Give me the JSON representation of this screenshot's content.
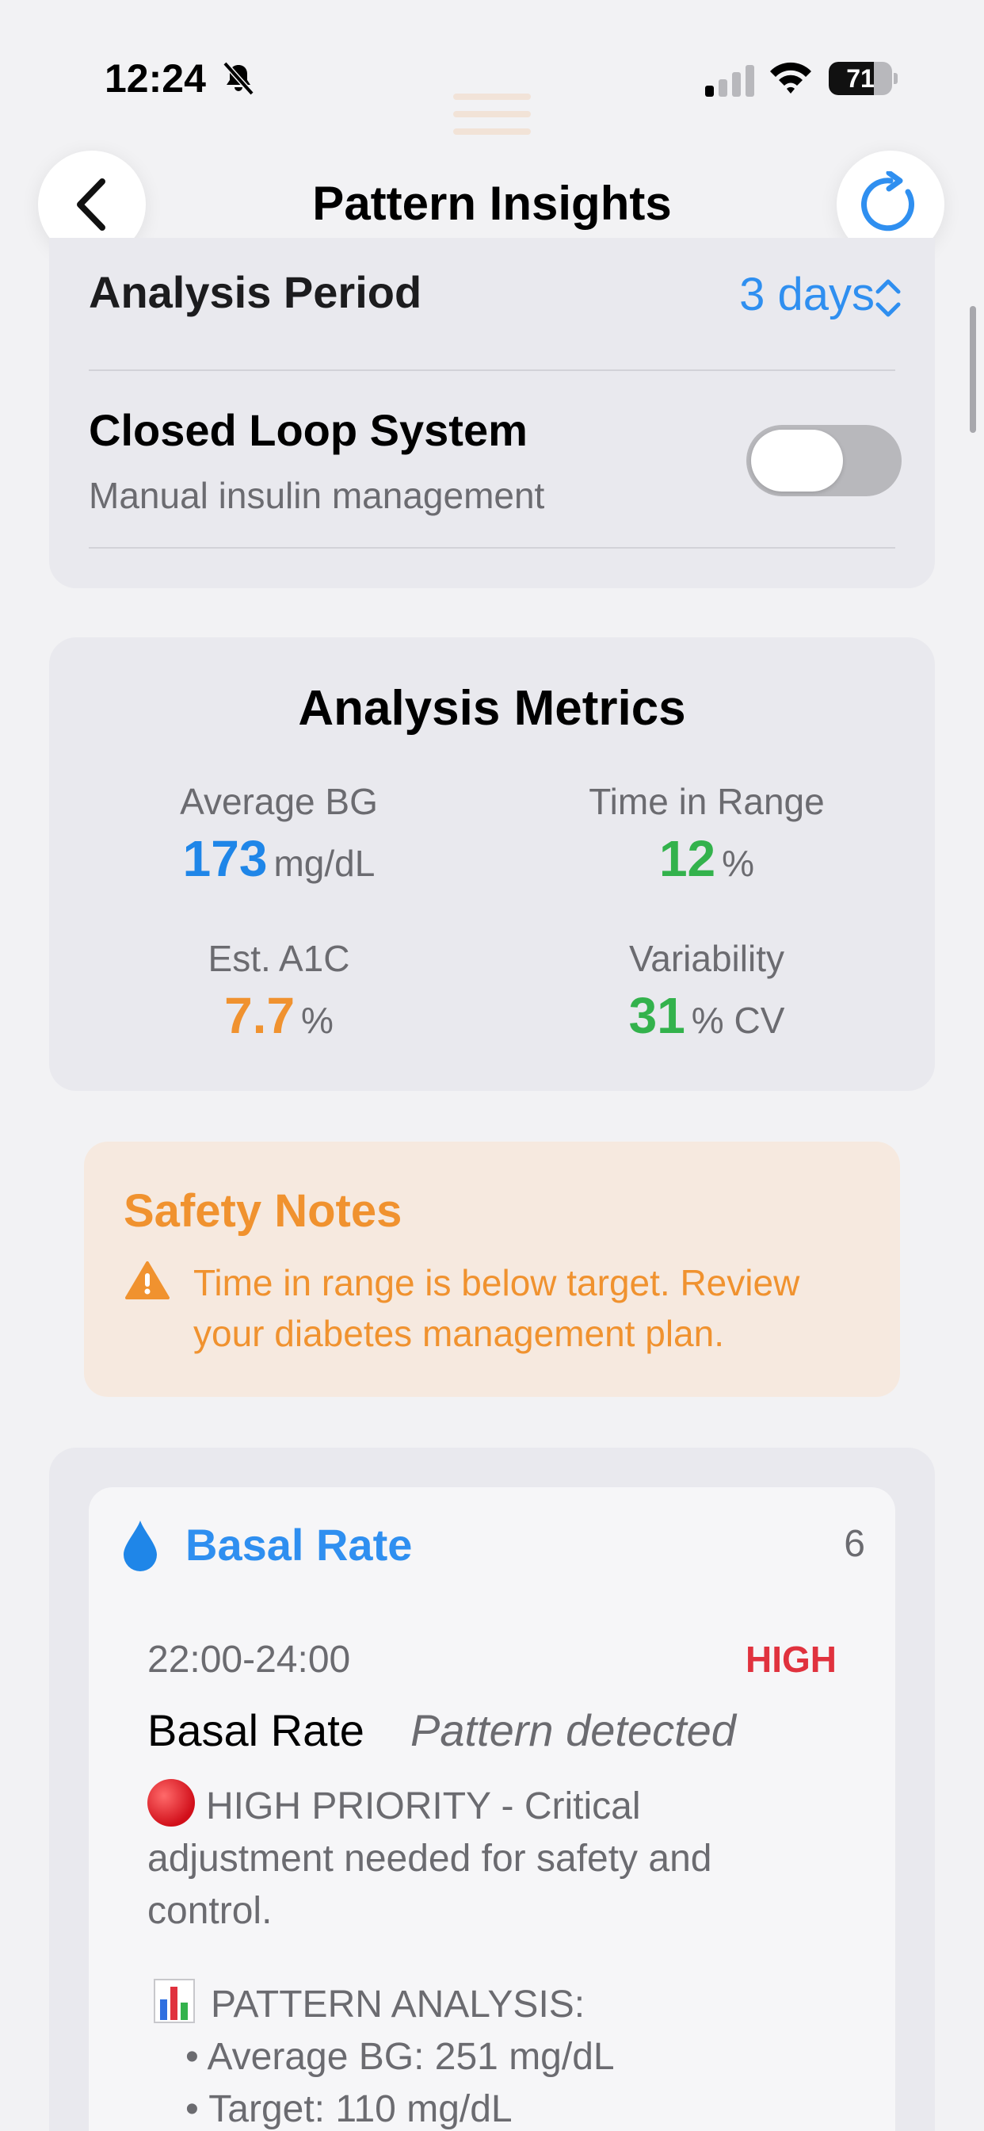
{
  "status_bar": {
    "time": "12:24",
    "battery": "71",
    "battery_level": 0.71
  },
  "nav": {
    "title": "Pattern Insights",
    "back_icon": "chevron-left-icon",
    "refresh_icon": "refresh-icon"
  },
  "settings": {
    "analysis_period_label": "Analysis Period",
    "analysis_period_value": "3 days",
    "closed_loop_label": "Closed Loop System",
    "closed_loop_subtitle": "Manual insulin management",
    "closed_loop_enabled": false
  },
  "metrics": {
    "title": "Analysis Metrics",
    "items": [
      {
        "label": "Average BG",
        "value": "173",
        "unit": "mg/dL",
        "color": "#1f86e8"
      },
      {
        "label": "Time in Range",
        "value": "12",
        "unit": "%",
        "color": "#33b24c"
      },
      {
        "label": "Est. A1C",
        "value": "7.7",
        "unit": "%",
        "color": "#f0922f"
      },
      {
        "label": "Variability",
        "value": "31",
        "unit": "% CV",
        "color": "#33b24c"
      }
    ]
  },
  "safety": {
    "title": "Safety Notes",
    "message": "Time in range is below target. Review your diabetes management plan.",
    "color": "#f0922f"
  },
  "recommendations": {
    "category": "Basal Rate",
    "count": "6",
    "items": [
      {
        "time_range": "22:00-24:00",
        "priority": "HIGH",
        "setting": "Basal Rate",
        "status": "Pattern detected",
        "priority_text": "HIGH PRIORITY - Critical adjustment needed for safety and control.",
        "analysis_header": "PATTERN ANALYSIS:",
        "analysis_bullets": [
          "• Average BG: 251 mg/dL",
          "• Target: 110 mg/dL"
        ]
      }
    ]
  },
  "colors": {
    "accent_blue": "#2f8ff0",
    "high_red": "#e0323e",
    "warning_orange": "#f0922f",
    "good_green": "#33b24c"
  }
}
